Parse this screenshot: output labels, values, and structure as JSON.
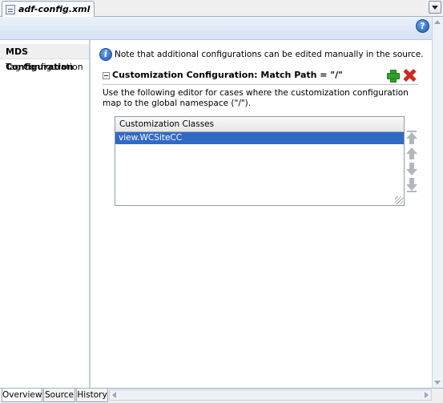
{
  "editor_tab": {
    "title": "adf-config.xml"
  },
  "header": {
    "help_label": "?"
  },
  "nav": {
    "items": [
      {
        "label": "MDS Configuration",
        "selected": true
      },
      {
        "label": "Tag Configuration",
        "selected": false
      }
    ]
  },
  "main": {
    "info_text": "Note that additional configurations can be edited manually in the source.",
    "info_icon_label": "i",
    "section": {
      "title": "Customization Configuration: Match Path = \"/\"",
      "description": "Use the following editor for cases where the customization configuration map to the global namespace (\"/\")."
    },
    "table": {
      "header": "Customization Classes",
      "rows": [
        {
          "value": "view.WCSiteCC",
          "selected": true
        }
      ]
    }
  },
  "bottom_tabs": [
    {
      "label": "Overview",
      "active": true
    },
    {
      "label": "Source",
      "active": false
    },
    {
      "label": "History",
      "active": false
    }
  ],
  "colors": {
    "selection": "#316ac5",
    "add": "#2fa12a",
    "delete": "#d3271e",
    "band": "#d5e2f3"
  }
}
